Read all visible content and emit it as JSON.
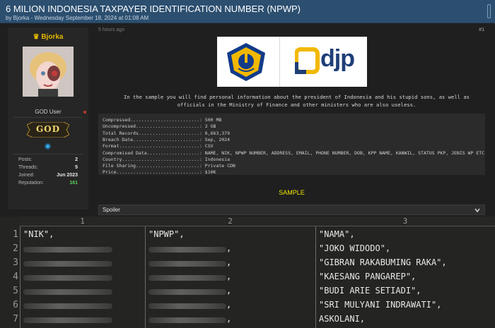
{
  "header": {
    "title": "6 MILION INDONESIA TAXPAYER IDENTIFICATION NUMBER (NPWP)",
    "byline": "by Bjorka - Wednesday September 18, 2024 at 01:08 AM"
  },
  "user": {
    "name": "Bjorka",
    "title": "GOD User",
    "rank": "GOD",
    "stats": [
      {
        "label": "Posts:",
        "value": "2"
      },
      {
        "label": "Threads:",
        "value": "5"
      },
      {
        "label": "Joined:",
        "value": "Jun 2023"
      },
      {
        "label": "Reputation:",
        "value": "161"
      }
    ]
  },
  "post": {
    "time": "5 hours ago",
    "number": "#1",
    "logo_text": "djp",
    "intro_line1": "In the sample you will find personal information about the president of Indonesia and his stupid sons, as well as",
    "intro_line2": "officials in the Ministry of Finance and other ministers who are also useless.",
    "details": [
      "Compressed.........................: 500 MB",
      "Uncompressed.......................: 2 GB",
      "Total Records......................: 6,663,379",
      "Breach Date........................: Sep, 2024",
      "Format.............................: CSV",
      "Compromised Data...................: NAME, NIK, NPWP NUMBER, ADDRESS, EMAIL, PHONE NUMBER, DOB, KPP NAME, KANWIL, STATUS PKP, JENIS WP ETC",
      "Country............................: Indonesia",
      "File Sharing.......................: Private CDN",
      "Price..............................: $10K"
    ],
    "sample_label": "SAMPLE",
    "spoiler_label": "Spoiler"
  },
  "sheet": {
    "columns": [
      "1",
      "2",
      "3"
    ],
    "rows": [
      {
        "n": "1",
        "c1": "\"NIK\",",
        "c2": "\"NPWP\",",
        "c3": "\"NAMA\","
      },
      {
        "n": "2",
        "c1": "",
        "c2": ",",
        "c3": "\"JOKO WIDODO\","
      },
      {
        "n": "3",
        "c1": "",
        "c2": ",",
        "c3": "\"GIBRAN RAKABUMING RAKA\","
      },
      {
        "n": "4",
        "c1": "",
        "c2": ",",
        "c3": "\"KAESANG PANGAREP\","
      },
      {
        "n": "5",
        "c1": "",
        "c2": ",",
        "c3": "\"BUDI ARIE SETIADI\","
      },
      {
        "n": "6",
        "c1": "",
        "c2": ",",
        "c3": "\"SRI MULYANI INDRAWATI\","
      },
      {
        "n": "7",
        "c1": "",
        "c2": ",",
        "c3": "ASKOLANI,"
      }
    ]
  }
}
